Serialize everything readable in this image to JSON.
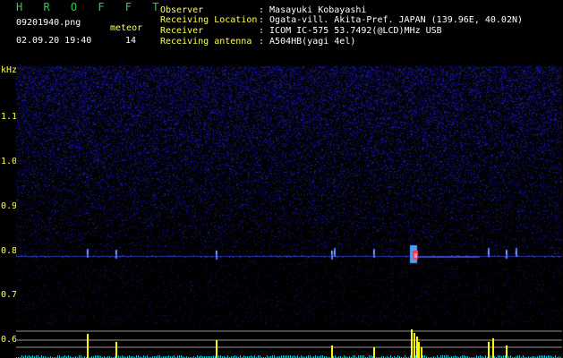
{
  "app": {
    "logo": "H R O F F T",
    "file_name": "09201940.png",
    "datetime": "02.09.20 19:40",
    "meteor_label": "meteor",
    "meteor_count": "14"
  },
  "info": [
    {
      "label": "Observer",
      "value": ": Masayuki Kobayashi"
    },
    {
      "label": "Receiving Location",
      "value": ": Ogata-vill. Akita-Pref. JAPAN (139.96E, 40.02N)"
    },
    {
      "label": "Receiver",
      "value": ": ICOM IC-575 53.7492(@LCD)MHz USB"
    },
    {
      "label": "Receiving antenna",
      "value": ": A504HB(yagi 4el)"
    }
  ],
  "axis": {
    "unit": "kHz",
    "x_ticks": [
      "1941",
      "1942",
      "1943",
      "1944",
      "1945",
      "1946",
      "1947",
      "1948",
      "1949",
      "1850"
    ],
    "y_ticks": [
      "1.1",
      "1.0",
      "0.9",
      "0.8",
      "0.7",
      "0.6"
    ]
  },
  "colors": {
    "background": "#000000",
    "noise": "#1c1c8c",
    "signal_line": "#3a4ad0",
    "meteor_core": "#ff3a3a",
    "lower_panel_line": "#c8c8c8",
    "meteor_bar": "#ffff00",
    "baseline_noise": "#00c8d8",
    "text_label": "#ffff55",
    "logo": "#2ecf45"
  }
}
